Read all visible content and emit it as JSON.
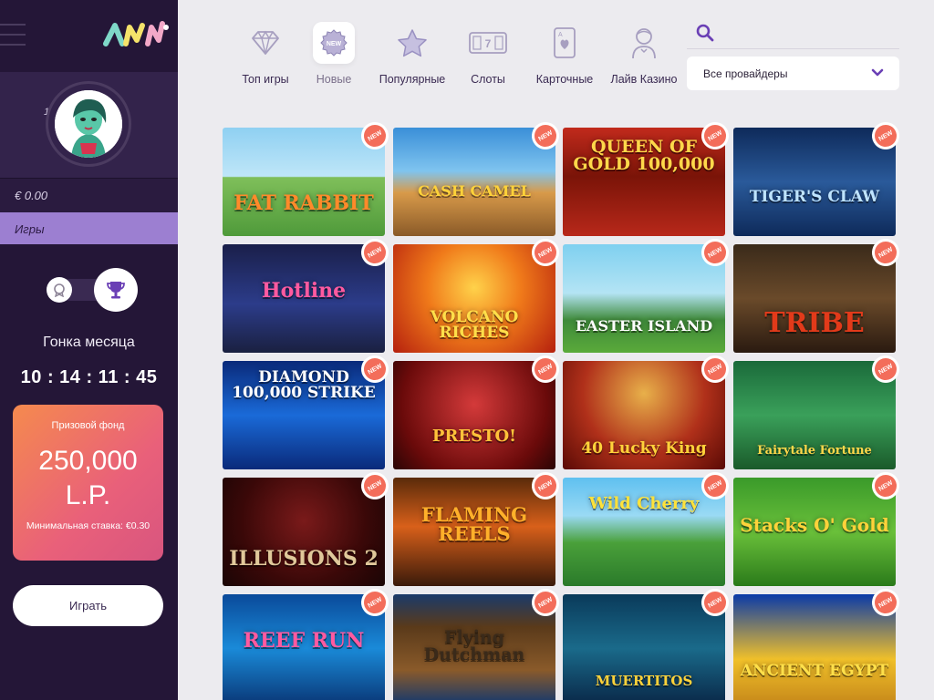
{
  "sidebar": {
    "level": "1",
    "balance": "€ 0.00",
    "games_tab": "Игры",
    "race_title": "Гонка месяца",
    "timer": "10 : 14 : 11 : 45",
    "prize_label": "Призовой фонд",
    "prize_value_line1": "250,000",
    "prize_value_line2": "L.P.",
    "min_bet": "Минимальная ставка: €0.30",
    "play_button": "Играть"
  },
  "nav": {
    "items": [
      {
        "label": "Топ игры",
        "icon": "diamond-icon"
      },
      {
        "label": "Новые",
        "icon": "new-badge-icon"
      },
      {
        "label": "Популярные",
        "icon": "star-icon"
      },
      {
        "label": "Слоты",
        "icon": "slot-machine-icon"
      },
      {
        "label": "Карточные",
        "icon": "playing-card-icon"
      },
      {
        "label": "Лайв Казино",
        "icon": "dealer-icon"
      }
    ],
    "active_index": 1
  },
  "provider_select": {
    "value": "Все провайдеры"
  },
  "badge_text": "NEW",
  "games": [
    {
      "title": "FAT RABBIT"
    },
    {
      "title": "CASH CAMEL"
    },
    {
      "title": "QUEEN OF GOLD 100,000"
    },
    {
      "title": "TIGER'S CLAW"
    },
    {
      "title": "Hotline"
    },
    {
      "title": "VOLCANO RICHES"
    },
    {
      "title": "EASTER ISLAND"
    },
    {
      "title": "TRIBE"
    },
    {
      "title": "DIAMOND 100,000 STRIKE"
    },
    {
      "title": "PRESTO!"
    },
    {
      "title": "40 Lucky King"
    },
    {
      "title": "Fairytale Fortune"
    },
    {
      "title": "ILLUSIONS 2"
    },
    {
      "title": "FLAMING REELS"
    },
    {
      "title": "Wild Cherry"
    },
    {
      "title": "Stacks O' Gold"
    },
    {
      "title": "REEF RUN"
    },
    {
      "title": "Flying Dutchman"
    },
    {
      "title": "MUERTITOS"
    },
    {
      "title": "ANCIENT EGYPT"
    }
  ],
  "colors": {
    "sidebar_bg": "#241637",
    "accent": "#9c7fd1",
    "badge": "#f36d5a",
    "page_bg": "#ecebef"
  }
}
